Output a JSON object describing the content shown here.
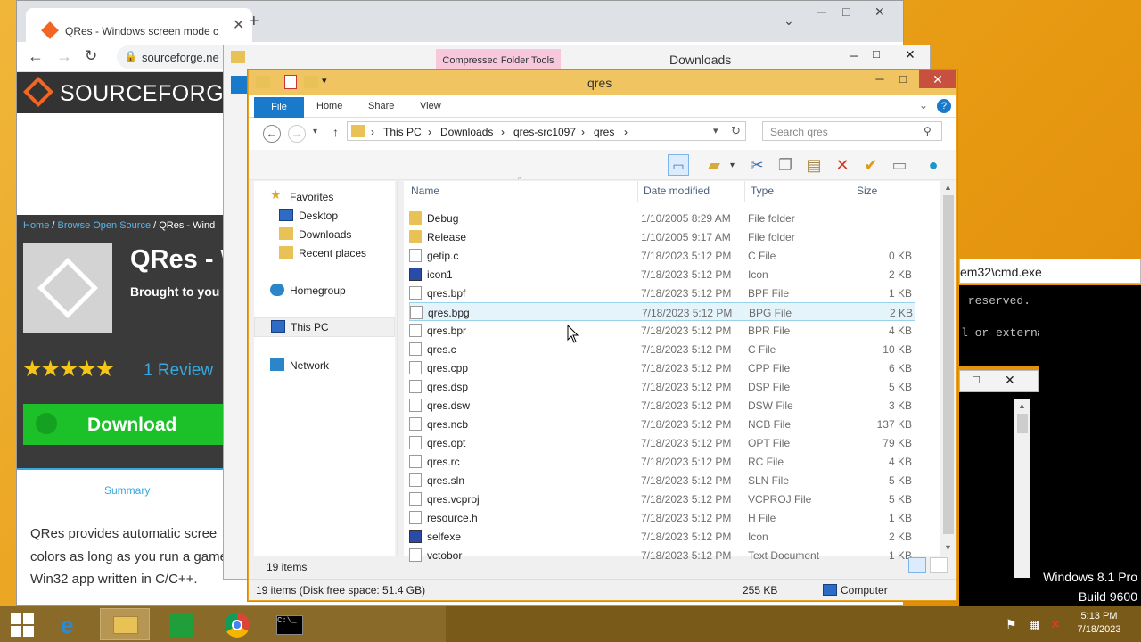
{
  "chrome": {
    "tab_title": "QRes - Windows screen mode c",
    "new_tab": "+",
    "address_partial": "sourceforge.ne",
    "sf_logo": "SOURCEFORGE",
    "breadcrumb_home": "Home",
    "breadcrumb_sep": " / ",
    "breadcrumb_browse": "Browse Open Source",
    "breadcrumb_tail": " / QRes - Wind",
    "project_title": "QRes - W",
    "project_sub": "Brought to you",
    "stars": "★★★★★",
    "review_link": "1 Review",
    "download_label": "Download",
    "summary_tab": "Summary",
    "desc_line1": "QRes provides automatic scree",
    "desc_line2": "colors as long as you run a game",
    "desc_line3": "Win32 app written in C/C++."
  },
  "downloads_window": {
    "title": "Downloads",
    "context_tab": "Compressed Folder Tools"
  },
  "cmd": {
    "title": "em32\\cmd.exe",
    "line1": " reserved.",
    "line2": "l or external command,"
  },
  "os_watermark": {
    "line1": "Windows 8.1 Pro",
    "line2": "Build 9600"
  },
  "explorer": {
    "title": "qres",
    "ribbon_tabs": [
      "File",
      "Home",
      "Share",
      "View"
    ],
    "breadcrumb": [
      "This PC",
      "Downloads",
      "qres-src1097",
      "qres"
    ],
    "search_placeholder": "Search qres",
    "columns": {
      "name": "Name",
      "date": "Date modified",
      "type": "Type",
      "size": "Size"
    },
    "nav": {
      "favorites": "Favorites",
      "desktop": "Desktop",
      "downloads": "Downloads",
      "recent": "Recent places",
      "homegroup": "Homegroup",
      "thispc": "This PC",
      "network": "Network"
    },
    "files": [
      {
        "name": "Debug",
        "date": "1/10/2005 8:29 AM",
        "type": "File folder",
        "size": "",
        "icon": "folder"
      },
      {
        "name": "Release",
        "date": "1/10/2005 9:17 AM",
        "type": "File folder",
        "size": "",
        "icon": "folder"
      },
      {
        "name": "getip.c",
        "date": "7/18/2023 5:12 PM",
        "type": "C File",
        "size": "0 KB",
        "icon": "file"
      },
      {
        "name": "icon1",
        "date": "7/18/2023 5:12 PM",
        "type": "Icon",
        "size": "2 KB",
        "icon": "icon"
      },
      {
        "name": "qres.bpf",
        "date": "7/18/2023 5:12 PM",
        "type": "BPF File",
        "size": "1 KB",
        "icon": "file"
      },
      {
        "name": "qres.bpg",
        "date": "7/18/2023 5:12 PM",
        "type": "BPG File",
        "size": "2 KB",
        "icon": "file",
        "selected": true
      },
      {
        "name": "qres.bpr",
        "date": "7/18/2023 5:12 PM",
        "type": "BPR File",
        "size": "4 KB",
        "icon": "file"
      },
      {
        "name": "qres.c",
        "date": "7/18/2023 5:12 PM",
        "type": "C File",
        "size": "10 KB",
        "icon": "file"
      },
      {
        "name": "qres.cpp",
        "date": "7/18/2023 5:12 PM",
        "type": "CPP File",
        "size": "6 KB",
        "icon": "file"
      },
      {
        "name": "qres.dsp",
        "date": "7/18/2023 5:12 PM",
        "type": "DSP File",
        "size": "5 KB",
        "icon": "file"
      },
      {
        "name": "qres.dsw",
        "date": "7/18/2023 5:12 PM",
        "type": "DSW File",
        "size": "3 KB",
        "icon": "file"
      },
      {
        "name": "qres.ncb",
        "date": "7/18/2023 5:12 PM",
        "type": "NCB File",
        "size": "137 KB",
        "icon": "file"
      },
      {
        "name": "qres.opt",
        "date": "7/18/2023 5:12 PM",
        "type": "OPT File",
        "size": "79 KB",
        "icon": "file"
      },
      {
        "name": "qres.rc",
        "date": "7/18/2023 5:12 PM",
        "type": "RC File",
        "size": "4 KB",
        "icon": "file"
      },
      {
        "name": "qres.sln",
        "date": "7/18/2023 5:12 PM",
        "type": "SLN File",
        "size": "5 KB",
        "icon": "file"
      },
      {
        "name": "qres.vcproj",
        "date": "7/18/2023 5:12 PM",
        "type": "VCPROJ File",
        "size": "5 KB",
        "icon": "file"
      },
      {
        "name": "resource.h",
        "date": "7/18/2023 5:12 PM",
        "type": "H File",
        "size": "1 KB",
        "icon": "file"
      },
      {
        "name": "selfexe",
        "date": "7/18/2023 5:12 PM",
        "type": "Icon",
        "size": "2 KB",
        "icon": "icon"
      },
      {
        "name": "vctobor",
        "date": "7/18/2023 5:12 PM",
        "type": "Text Document",
        "size": "1 KB",
        "icon": "file"
      }
    ],
    "item_count": "19 items",
    "status_items": "19 items (Disk free space: 51.4 GB)",
    "status_size": "255 KB",
    "status_location": "Computer"
  },
  "taskbar": {
    "time": "5:13 PM",
    "date": "7/18/2023"
  },
  "colors": {
    "explorer_title": "#f1c462",
    "file_tab": "#1979ca",
    "selection": "#e5f3fb",
    "sf_green": "#1cc12a"
  }
}
